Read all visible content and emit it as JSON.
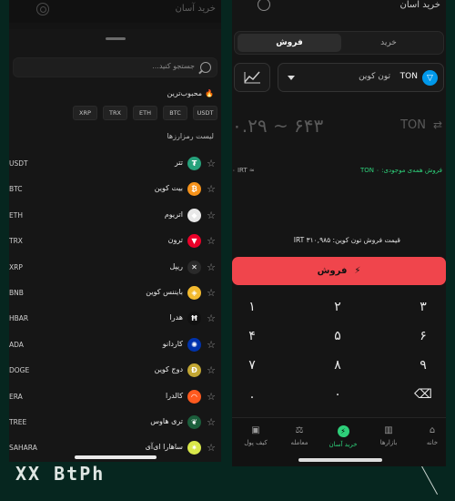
{
  "brand": {
    "logo_text": "XX BtPh"
  },
  "left_panel": {
    "title": "خرید آسان",
    "search_placeholder": "جستجو کنید...",
    "favorites_title": "محبوب‌ترین",
    "favorite_chips": [
      "USDT",
      "BTC",
      "ETH",
      "TRX",
      "XRP"
    ],
    "market_list_title": "لیست رمزارزها",
    "coins": [
      {
        "symbol": "USDT",
        "name": "تتر",
        "icon": "tether-icon",
        "color": "#26a17b",
        "glyph": "₮"
      },
      {
        "symbol": "BTC",
        "name": "بیت کوین",
        "icon": "bitcoin-icon",
        "color": "#f7931a",
        "glyph": "₿"
      },
      {
        "symbol": "ETH",
        "name": "اتریوم",
        "icon": "ethereum-icon",
        "color": "#e8e8e8",
        "glyph": "◆"
      },
      {
        "symbol": "TRX",
        "name": "ترون",
        "icon": "tron-icon",
        "color": "#eb0029",
        "glyph": "▼"
      },
      {
        "symbol": "XRP",
        "name": "ریپل",
        "icon": "ripple-icon",
        "color": "#2a2a2a",
        "glyph": "✕"
      },
      {
        "symbol": "BNB",
        "name": "بایننس کوین",
        "icon": "bnb-icon",
        "color": "#f3ba2f",
        "glyph": "◈"
      },
      {
        "symbol": "HBAR",
        "name": "هدرا",
        "icon": "hedera-icon",
        "color": "#111111",
        "glyph": "Ħ"
      },
      {
        "symbol": "ADA",
        "name": "کاردانو",
        "icon": "cardano-icon",
        "color": "#0033ad",
        "glyph": "✺"
      },
      {
        "symbol": "DOGE",
        "name": "دوج کوین",
        "icon": "dogecoin-icon",
        "color": "#c2a633",
        "glyph": "Ð"
      },
      {
        "symbol": "ERA",
        "name": "کالدرا",
        "icon": "caldera-icon",
        "color": "#ff5a1f",
        "glyph": "◠"
      },
      {
        "symbol": "TREE",
        "name": "تری هاوس",
        "icon": "treehouse-icon",
        "color": "#1b5e3b",
        "glyph": "❦"
      },
      {
        "symbol": "SAHARA",
        "name": "ساهارا ای‌آی",
        "icon": "sahara-icon",
        "color": "#d9e84a",
        "glyph": "✷"
      }
    ]
  },
  "right_panel": {
    "title": "خرید آسان",
    "tabs": {
      "buy": "خرید",
      "sell": "فروش"
    },
    "coin_code": "TON",
    "coin_name": "تون کوین",
    "amount_display": "۰.۲۹ ~ ۶۴۳",
    "amount_code": "TON",
    "balance_left": "۰ IRT ≈",
    "balance_right": "فروش همه‌ی موجودی: TON ۰",
    "price_label": "قیمت فروش تون کوین:",
    "price_value": "۳۱۰,۹۸۵ IRT",
    "sell_button": "فروش",
    "keypad": [
      "۳",
      "۲",
      "۱",
      "۶",
      "۵",
      "۴",
      "۹",
      "۸",
      "۷",
      "⌫",
      "۰",
      "."
    ],
    "nav": [
      {
        "label": "خانه",
        "icon": "home-icon"
      },
      {
        "label": "بازارها",
        "icon": "markets-icon"
      },
      {
        "label": "خرید آسان",
        "icon": "easy-buy-icon"
      },
      {
        "label": "معامله",
        "icon": "trade-icon"
      },
      {
        "label": "کیف پول",
        "icon": "wallet-icon"
      }
    ]
  },
  "colors": {
    "background": "#06261f",
    "sell": "#f0454c",
    "accent": "#2ed07a",
    "ton": "#0098ea"
  }
}
